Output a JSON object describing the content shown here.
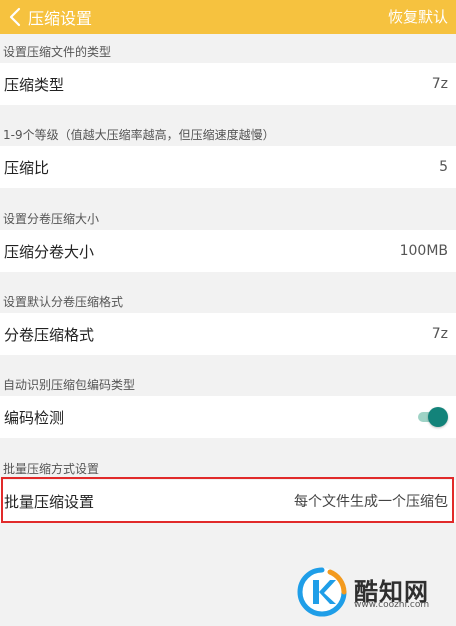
{
  "appbar": {
    "title": "压缩设置",
    "reset_label": "恢复默认"
  },
  "sections": [
    {
      "header": "设置压缩文件的类型",
      "label": "压缩类型",
      "value": "7z"
    },
    {
      "header": "1-9个等级（值越大压缩率越高，但压缩速度越慢）",
      "label": "压缩比",
      "value": "5"
    },
    {
      "header": "设置分卷压缩大小",
      "label": "压缩分卷大小",
      "value": "100MB"
    },
    {
      "header": "设置默认分卷压缩格式",
      "label": "分卷压缩格式",
      "value": "7z"
    },
    {
      "header": "自动识别压缩包编码类型",
      "label": "编码检测",
      "toggle_on": true
    },
    {
      "header": "批量压缩方式设置",
      "label": "批量压缩设置",
      "value": "每个文件生成一个压缩包"
    }
  ],
  "colors": {
    "appbar": "#f6c23f",
    "toggle": "#13837a",
    "highlight": "#e12a2a"
  },
  "watermark": {
    "name": "酷知网",
    "url": "www.coozhi.com"
  }
}
